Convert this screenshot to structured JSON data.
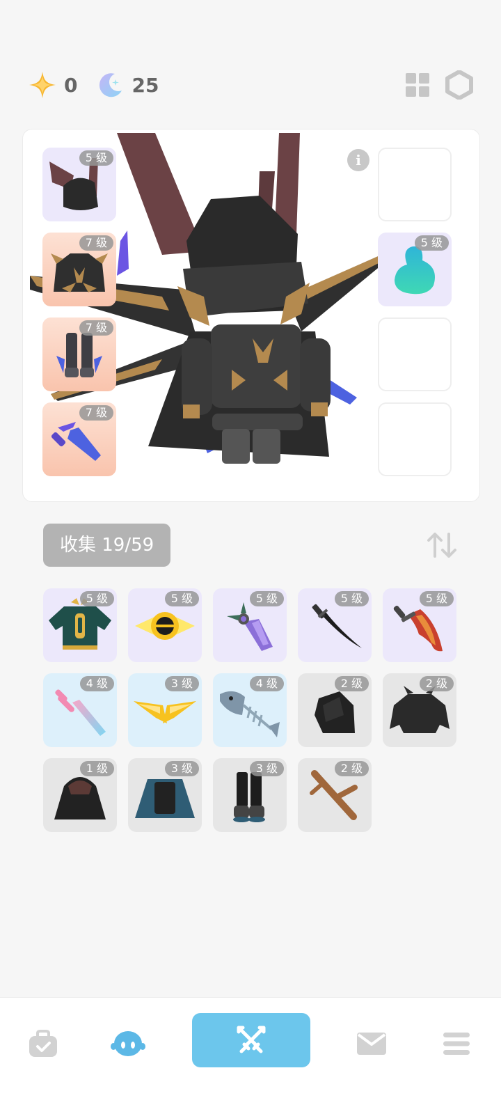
{
  "currency": {
    "star": {
      "icon": "sparkle-star-icon",
      "value": "0",
      "color": "#f6b93b"
    },
    "moon": {
      "icon": "moon-icon",
      "value": "25",
      "color": "#a9b8f5"
    }
  },
  "top_icons": [
    "grid-layout-icon",
    "hexagon-settings-icon"
  ],
  "equipped_left": [
    {
      "name": "bat-wing-helmet",
      "level": "5 级",
      "rarity": "purple"
    },
    {
      "name": "dark-armor",
      "level": "7 级",
      "rarity": "orange"
    },
    {
      "name": "dark-boots",
      "level": "7 级",
      "rarity": "orange"
    },
    {
      "name": "crystal-sword",
      "level": "7 级",
      "rarity": "orange"
    }
  ],
  "equipped_right": [
    {
      "name": "empty-slot",
      "level": "",
      "rarity": "empty"
    },
    {
      "name": "teal-blob-pet",
      "level": "5 级",
      "rarity": "purple"
    },
    {
      "name": "empty-slot",
      "level": "",
      "rarity": "empty"
    },
    {
      "name": "empty-slot",
      "level": "",
      "rarity": "empty"
    }
  ],
  "collect": {
    "label": "收集 19/59"
  },
  "inventory": [
    {
      "name": "teal-tunic",
      "level": "5 级",
      "rarity": "purple"
    },
    {
      "name": "golden-eye-ring",
      "level": "5 级",
      "rarity": "purple"
    },
    {
      "name": "crystal-dagger",
      "level": "5 级",
      "rarity": "purple"
    },
    {
      "name": "black-katana",
      "level": "5 级",
      "rarity": "purple"
    },
    {
      "name": "flame-sword",
      "level": "5 级",
      "rarity": "purple"
    },
    {
      "name": "pink-sword",
      "level": "4 级",
      "rarity": "blue"
    },
    {
      "name": "golden-wings",
      "level": "3 级",
      "rarity": "blue"
    },
    {
      "name": "fishbone-weapon",
      "level": "4 级",
      "rarity": "blue"
    },
    {
      "name": "black-hood",
      "level": "2 级",
      "rarity": "gray"
    },
    {
      "name": "black-armor",
      "level": "2 级",
      "rarity": "gray"
    },
    {
      "name": "hooded-cloak",
      "level": "1 级",
      "rarity": "gray"
    },
    {
      "name": "blue-cape",
      "level": "3 级",
      "rarity": "gray"
    },
    {
      "name": "black-pants",
      "level": "3 级",
      "rarity": "gray"
    },
    {
      "name": "wooden-branch",
      "level": "2 级",
      "rarity": "gray"
    }
  ],
  "nav": [
    "bag-icon",
    "character-icon",
    "battle-swords-icon",
    "mail-icon",
    "menu-icon"
  ],
  "colors": {
    "accent": "#6cc6ec",
    "badge": "#969696",
    "purple_slot": "#ece8fb",
    "orange_slot": "#fbcfbb",
    "blue_slot": "#ddf0fb",
    "gray_slot": "#e6e6e6"
  }
}
